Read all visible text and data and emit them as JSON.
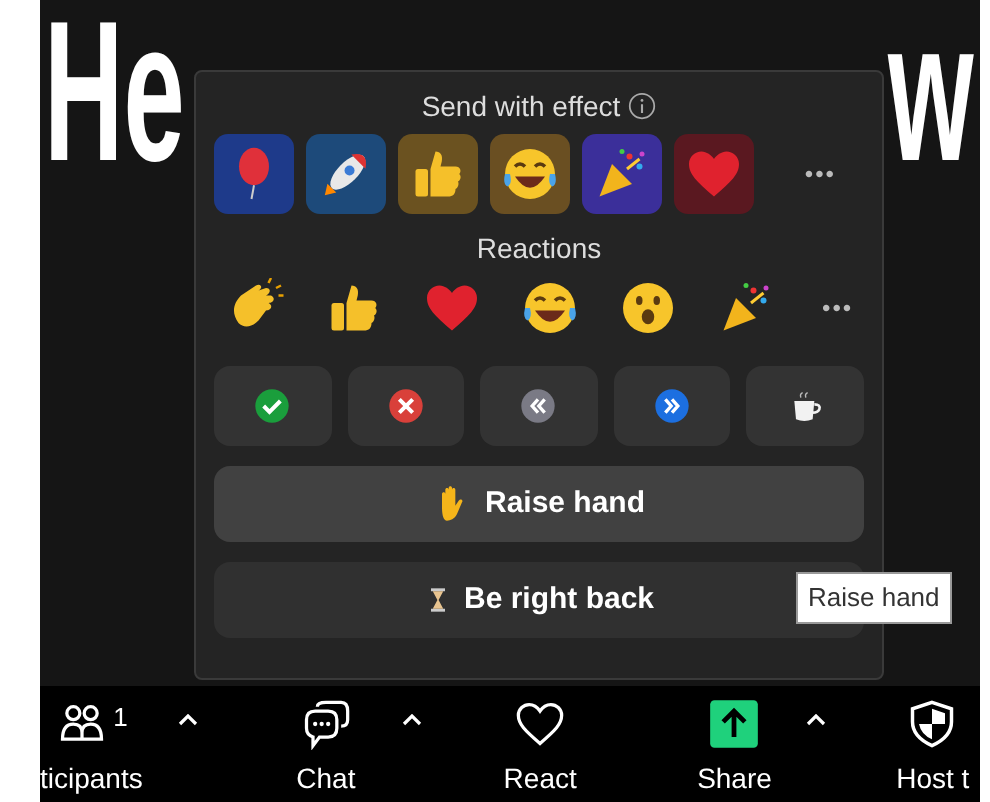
{
  "video": {
    "name_parts": [
      "He",
      "w"
    ]
  },
  "popup": {
    "effects_title": "Send with effect",
    "effects": [
      {
        "kind": "balloon"
      },
      {
        "kind": "rocket"
      },
      {
        "kind": "thumbs"
      },
      {
        "kind": "joy"
      },
      {
        "kind": "party"
      },
      {
        "kind": "heart"
      }
    ],
    "effects_more": "•••",
    "reactions_title": "Reactions",
    "reactions": [
      {
        "kind": "clap"
      },
      {
        "kind": "thumbs"
      },
      {
        "kind": "heart"
      },
      {
        "kind": "joy"
      },
      {
        "kind": "wow"
      },
      {
        "kind": "party"
      }
    ],
    "reactions_more": "•••",
    "status_buttons": [
      {
        "kind": "yes"
      },
      {
        "kind": "no"
      },
      {
        "kind": "slower"
      },
      {
        "kind": "faster"
      },
      {
        "kind": "coffee"
      }
    ],
    "actions": [
      {
        "kind": "hand",
        "label": "Raise hand",
        "hovered": true
      },
      {
        "kind": "hourglass",
        "label": "Be right back",
        "hovered": false
      }
    ]
  },
  "tooltip": "Raise hand",
  "toolbar": [
    {
      "kind": "participants",
      "label": "ticipants",
      "count": "1",
      "caret": true
    },
    {
      "kind": "chat",
      "label": "Chat",
      "caret": true
    },
    {
      "kind": "react",
      "label": "React",
      "caret": false
    },
    {
      "kind": "share",
      "label": "Share",
      "caret": true
    },
    {
      "kind": "host",
      "label": "Host t",
      "caret": false
    }
  ]
}
